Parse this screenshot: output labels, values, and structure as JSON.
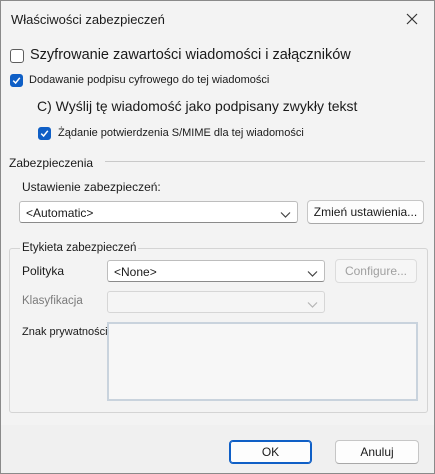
{
  "window": {
    "title": "Właściwości zabezpieczeń"
  },
  "options": {
    "encrypt": {
      "label": "Szyfrowanie zawartości wiadomości i załączników",
      "checked": false
    },
    "sign": {
      "label": "Dodawanie podpisu cyfrowego do tej wiadomości",
      "checked": true
    },
    "send_clear": {
      "label": "C) Wyślij tę wiadomość jako podpisany zwykły tekst"
    },
    "smime_receipt": {
      "label": "Żądanie potwierdzenia S/MIME dla tej wiadomości",
      "checked": true
    }
  },
  "security": {
    "section_label": "Zabezpieczenia",
    "setting_label": "Ustawienie zabezpieczeń:",
    "setting_value": "<Automatic>",
    "change_button": "Zmień ustawienia..."
  },
  "label_group": {
    "title": "Etykieta zabezpieczeń",
    "policy_label": "Polityka",
    "policy_value": "<None>",
    "configure_button": "Configure...",
    "classification_label": "Klasyfikacja",
    "classification_value": "",
    "privacy_label": "Znak prywatności:"
  },
  "footer": {
    "ok": "OK",
    "cancel": "Anuluj"
  },
  "colors": {
    "accent": "#0f5fc6"
  }
}
